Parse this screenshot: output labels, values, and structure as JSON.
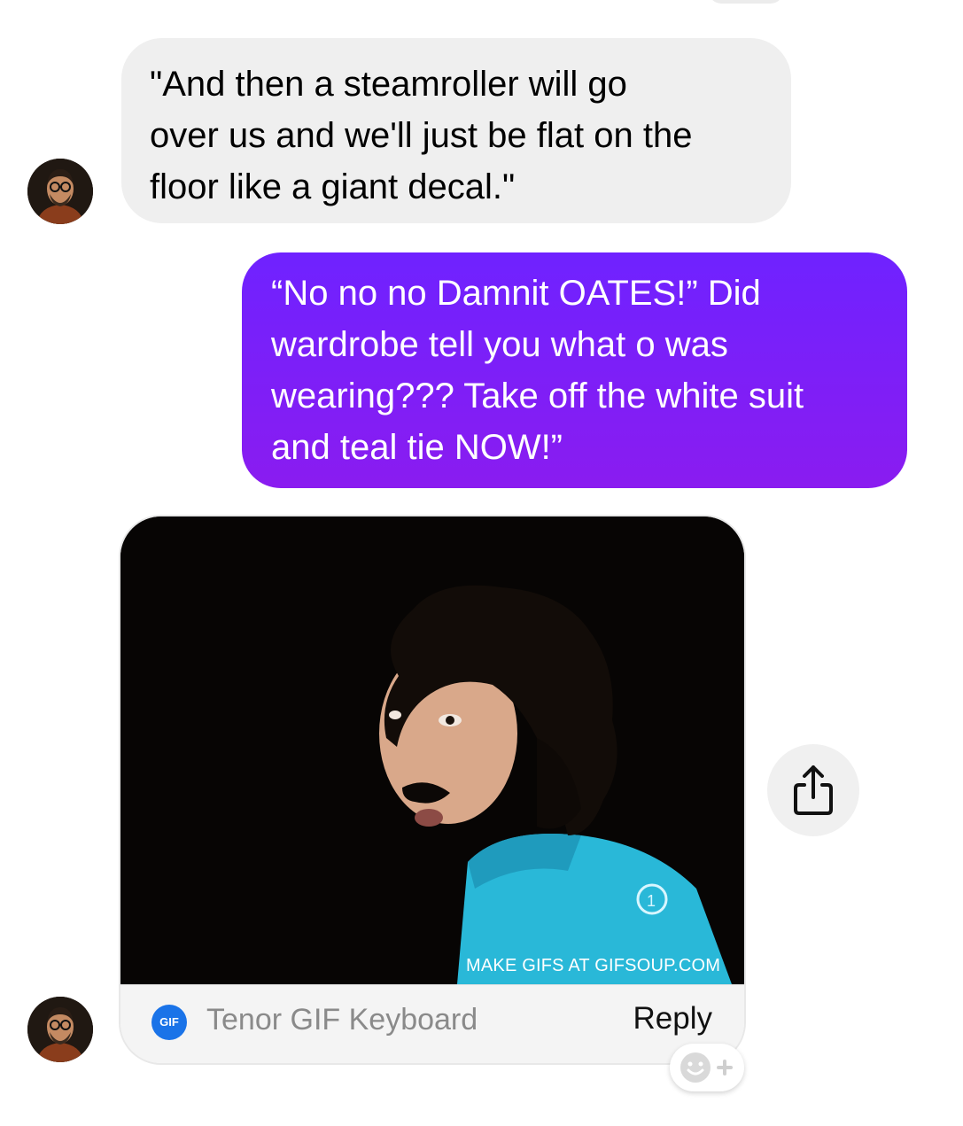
{
  "thread": {
    "messages": [
      {
        "direction": "incoming",
        "type": "text",
        "text": "\"And then a steamroller will go\nover us and we'll just be flat on the\nfloor like a giant decal.\""
      },
      {
        "direction": "outgoing",
        "type": "text",
        "text": "“No no no Damnit OATES!”  Did\nwardrobe tell you what o was\nwearing???  Take off the white suit\nand teal tie NOW!”"
      },
      {
        "direction": "incoming",
        "type": "gif",
        "gif_caption": "MAKE GIFS AT GIFSOUP.COM",
        "source_logo_text": "GIF",
        "source_name": "Tenor GIF Keyboard",
        "reply_label": "Reply"
      }
    ]
  },
  "icons": {
    "share": "share-icon",
    "add_reaction": "add-reaction-icon",
    "avatar": "avatar"
  },
  "colors": {
    "incoming_bubble": "#efefef",
    "outgoing_bubble_top": "#6f22ff",
    "outgoing_bubble_bottom": "#8a1cf0",
    "tenor_blue": "#1a73e8"
  }
}
